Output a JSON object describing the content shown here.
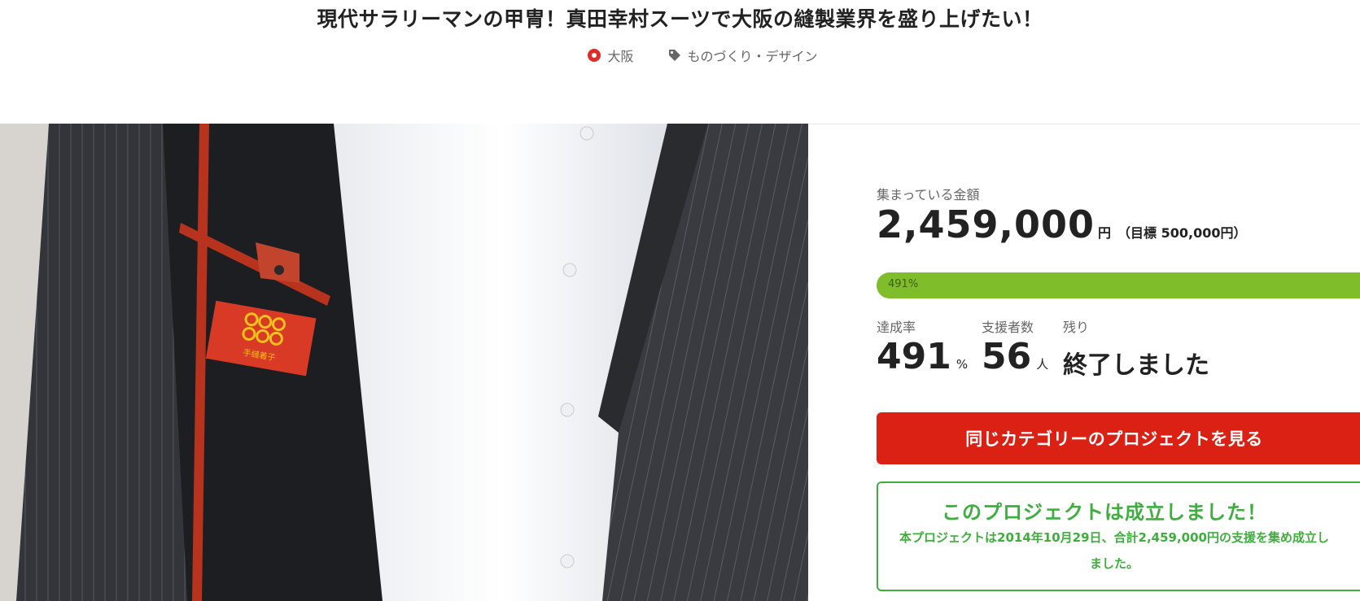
{
  "project": {
    "title": "現代サラリーマンの甲冑！真田幸村スーツで大阪の縫製業界を盛り上げたい！",
    "location": "大阪",
    "category": "ものづくり・デザイン",
    "location_icon": "map-pin-icon",
    "category_icon": "tag-icon"
  },
  "funding": {
    "raised_label": "集まっている金額",
    "raised_amount": "2,459,000",
    "raised_unit": "円",
    "goal_text": "（目標 500,000円）",
    "progress_text": "491%",
    "progress_fill": 1.0,
    "accent_color": "#7fbd2a"
  },
  "stats": {
    "rate_label": "達成率",
    "rate_value": "491",
    "rate_unit": "%",
    "backers_label": "支援者数",
    "backers_value": "56",
    "backers_unit": "人",
    "remaining_label": "残り",
    "remaining_value": "終了しました"
  },
  "cta": {
    "label": "同じカテゴリーのプロジェクトを見る",
    "color": "#db2114"
  },
  "success": {
    "title": "このプロジェクトは成立しました！",
    "body": "本プロジェクトは2014年10月29日、合計2,459,000円の支援を集め成立しました。",
    "color": "#3eae3e"
  },
  "photo": {
    "badge_text": "手縫着子"
  }
}
